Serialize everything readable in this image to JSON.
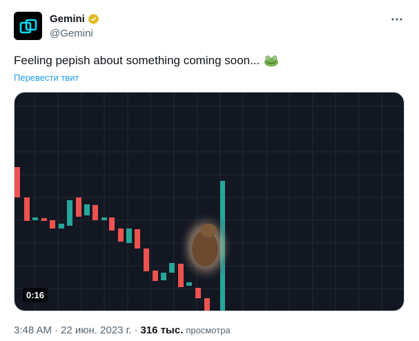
{
  "author": {
    "display_name": "Gemini",
    "handle": "@Gemini",
    "avatar_icon": "gemini-logo-icon",
    "verified_icon": "verified-gold-badge-icon"
  },
  "tweet": {
    "text": "Feeling pepish about something coming soon...",
    "emoji_icon": "frog-face-emoji-icon",
    "translate_label": "Перевести твит"
  },
  "media": {
    "duration": "0:16",
    "background_color": "#131722",
    "up_color": "#26a69a",
    "down_color": "#ef5350"
  },
  "meta": {
    "time": "3:48 AM",
    "date": "22 июн. 2023 г.",
    "separator1": "·",
    "separator2": "·",
    "views_count": "316 тыс.",
    "views_label": "просмотра"
  },
  "colors": {
    "link": "#1d9bf0",
    "secondary_text": "#536471",
    "primary_text": "#0f1419"
  }
}
